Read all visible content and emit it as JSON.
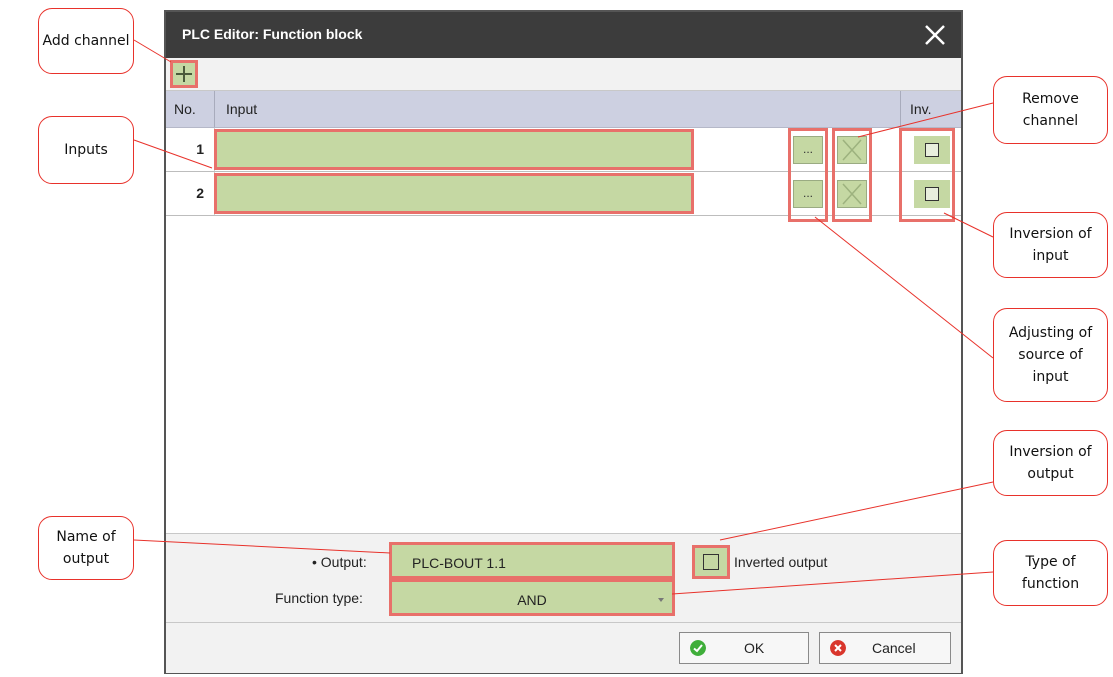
{
  "dialog": {
    "title": "PLC Editor: Function block",
    "close_icon": "close-icon",
    "add_icon": "plus-icon"
  },
  "table": {
    "headers": {
      "no": "No.",
      "input": "Input",
      "inv": "Inv."
    },
    "rows": [
      {
        "no": "1",
        "input": "",
        "select_label": "...",
        "inverted": false
      },
      {
        "no": "2",
        "input": "",
        "select_label": "...",
        "inverted": false
      }
    ]
  },
  "footer": {
    "output_label": "• Output:",
    "output_value": "PLC-BOUT 1.1",
    "inverted_output_label": "Inverted output",
    "inverted_output": false,
    "function_type_label": "Function type:",
    "function_type_value": "AND"
  },
  "buttons": {
    "ok": "OK",
    "cancel": "Cancel"
  },
  "callouts": {
    "add_channel": "Add channel",
    "inputs": "Inputs",
    "remove_channel_1": "Remove",
    "remove_channel_2": "channel",
    "inversion_input_1": "Inversion of",
    "inversion_input_2": "input",
    "adjusting_1": "Adjusting of",
    "adjusting_2": "source of",
    "adjusting_3": "input",
    "inversion_output_1": "Inversion of",
    "inversion_output_2": "output",
    "name_output_1": "Name of",
    "name_output_2": "output",
    "type_function_1": "Type of",
    "type_function_2": "function"
  },
  "colors": {
    "highlight": "#e8706a",
    "field_green": "#c5d8a3",
    "callout_border": "#e8322b",
    "titlebar": "#3c3c3c",
    "ok_icon": "#3fae3a",
    "cancel_icon": "#d9362c"
  }
}
